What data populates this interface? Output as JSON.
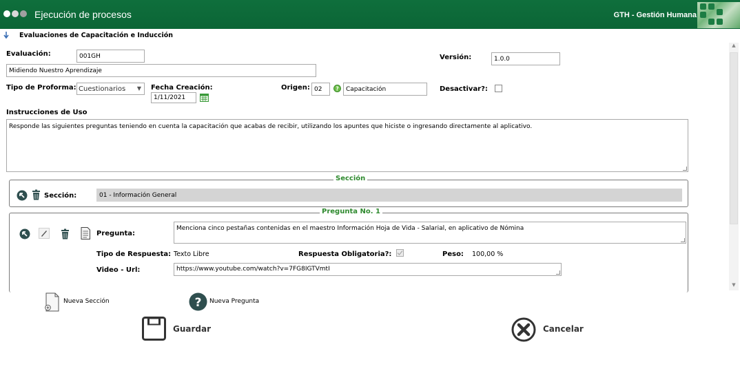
{
  "header": {
    "title": "Ejecución de procesos",
    "module": "GTH - Gestión Humana",
    "dot_colors": [
      "#ffffff",
      "#d8d8d8",
      "#a0a0a0"
    ],
    "brand_color": "#0f6f3c"
  },
  "breadcrumb": {
    "title": "Evaluaciones de Capacitación e Inducción"
  },
  "form": {
    "evaluacion_label": "Evaluación:",
    "evaluacion_code": "001GH",
    "evaluacion_name": "Midiendo Nuestro Aprendizaje",
    "version_label": "Versión:",
    "version_value": "1.0.0",
    "tipo_proforma_label": "Tipo de Proforma:",
    "tipo_proforma_value": "Cuestionarios",
    "fecha_label": "Fecha Creación:",
    "fecha_value": "1/11/2021",
    "origen_label": "Origen:",
    "origen_code": "02",
    "origen_name": "Capacitación",
    "desactivar_label": "Desactivar?:",
    "instrucciones_label": "Instrucciones de Uso",
    "instrucciones_value": "Responde las siguientes preguntas teniendo en cuenta la capacitación que acabas de recibir, utilizando los apuntes que hiciste o ingresando directamente al aplicativo."
  },
  "seccion": {
    "legend": "Sección",
    "label": "Sección:",
    "value": "01 - Información General"
  },
  "pregunta": {
    "legend": "Pregunta No. 1",
    "pregunta_label": "Pregunta:",
    "pregunta_value": "Menciona cinco pestañas contenidas en el maestro Información Hoja de Vida - Salarial, en aplicativo de Nómina",
    "tipo_label": "Tipo de Respuesta:",
    "tipo_value": "Texto Libre",
    "obligatoria_label": "Respuesta Obligatoria?:",
    "peso_label": "Peso:",
    "peso_value": "100,00 %",
    "video_label": "Video - Url:",
    "video_value": "https://www.youtube.com/watch?v=7FG8IGTVmtI"
  },
  "actions": {
    "nueva_seccion": "Nueva Sección",
    "nueva_pregunta": "Nueva Pregunta",
    "guardar": "Guardar",
    "cancelar": "Cancelar"
  }
}
